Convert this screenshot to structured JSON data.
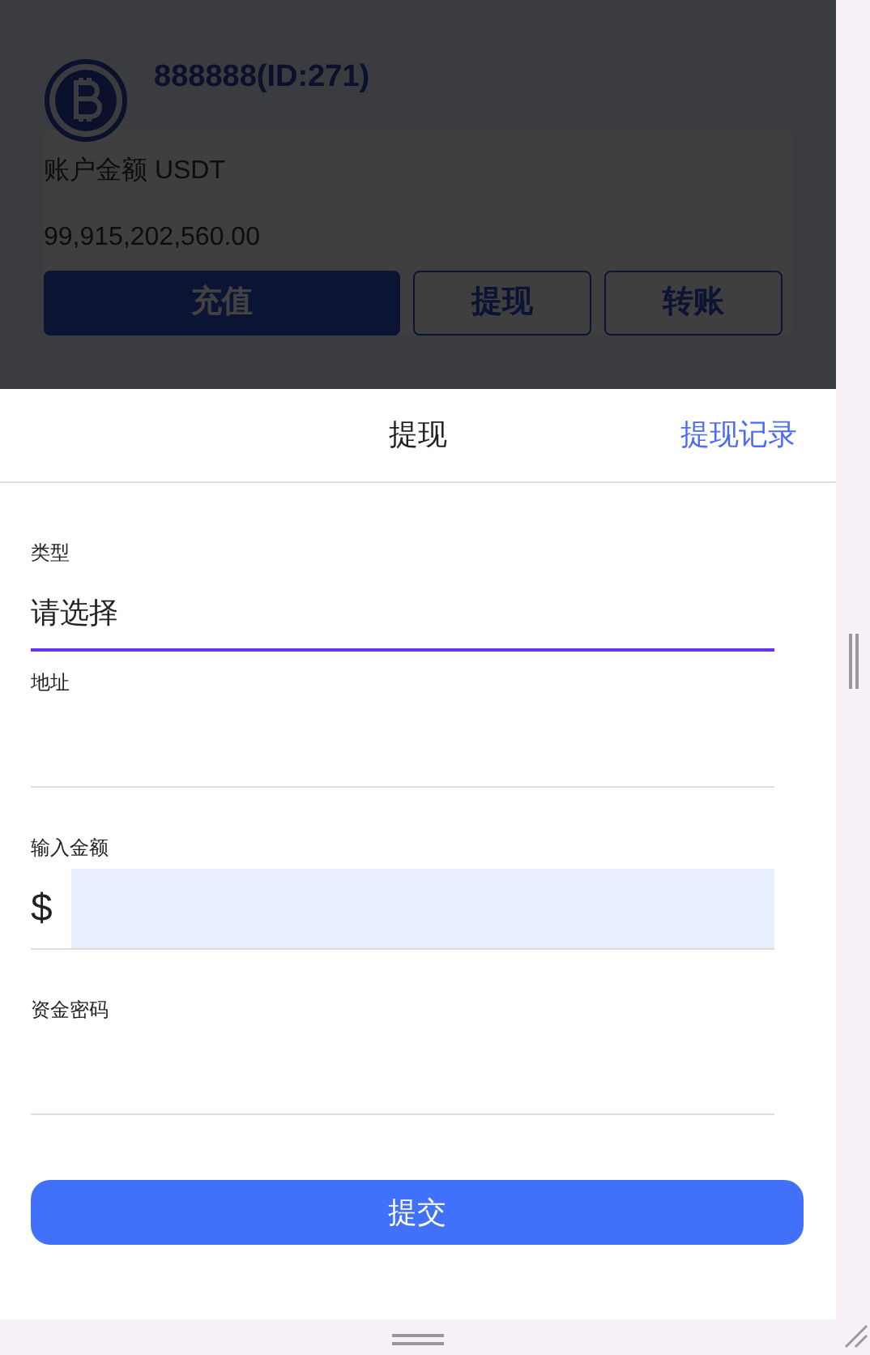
{
  "account": {
    "name": "888888(ID:271)",
    "balance_label": "账户金额 USDT",
    "balance": "99,915,202,560.00",
    "actions": [
      {
        "label": "充值",
        "kind": "primary"
      },
      {
        "label": "提现",
        "kind": "outline"
      },
      {
        "label": "转账",
        "kind": "outline"
      }
    ]
  },
  "sheet": {
    "title": "提现",
    "history_link": "提现记录",
    "fields": [
      {
        "label": "类型",
        "kind": "select",
        "value": "请选择",
        "focused": true
      },
      {
        "label": "地址",
        "kind": "text",
        "focused": false
      },
      {
        "label": "输入金额",
        "kind": "amount",
        "prefix": "$",
        "focused": false
      },
      {
        "label": "资金密码",
        "kind": "password",
        "focused": false
      }
    ],
    "submit": "提交"
  }
}
